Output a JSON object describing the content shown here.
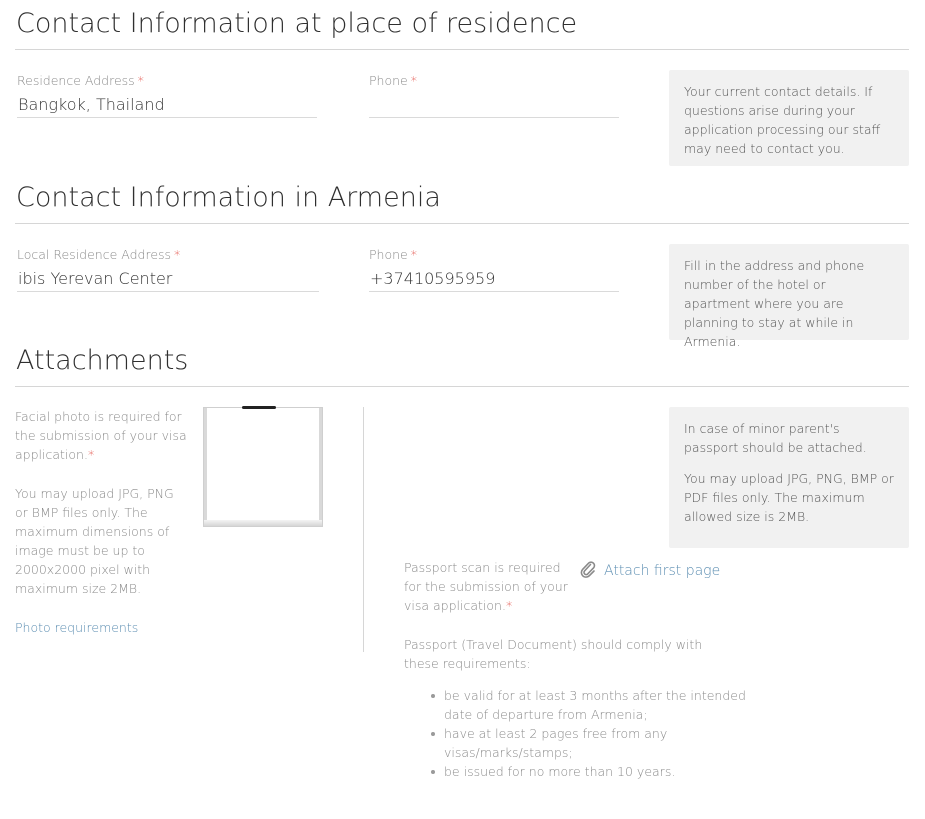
{
  "section_residence": {
    "title": "Contact Information at place of residence",
    "address_label": "Residence Address",
    "address_value": "Bangkok, Thailand",
    "phone_label": "Phone",
    "phone_value": "",
    "required_mark": "*",
    "info": "Your current contact details. If questions arise during your application processing our staff may need to contact you."
  },
  "section_armenia": {
    "title": "Contact Information in Armenia",
    "address_label": "Local Residence Address",
    "address_value": "ibis Yerevan Center",
    "phone_label": "Phone",
    "phone_value": "+37410595959",
    "required_mark": "*",
    "info": "Fill in the address and phone number of the hotel or apartment where you are planning to stay at while in Armenia."
  },
  "section_attachments": {
    "title": "Attachments",
    "photo_required": "Facial photo is required for the submission of your visa application.",
    "required_mark": "*",
    "photo_formats": "You may upload JPG, PNG or BMP files only. The maximum dimensions of image must be up to 2000x2000 pixel with maximum size 2MB.",
    "photo_requirements_link": "Photo requirements",
    "info_minor": "In case of minor parent's passport should be attached.",
    "info_formats": "You may upload JPG, PNG, BMP or PDF files only. The maximum allowed size is 2MB.",
    "passport_required": "Passport scan is required for the submission of your visa application.",
    "attach_label": "Attach first page",
    "passport_comply": "Passport (Travel Document) should comply with these requirements:",
    "requirements": [
      "be valid for at least 3 months after the intended date of departure from Armenia;",
      "have at least 2 pages free from any visas/marks/stamps;",
      "be issued for no more than 10 years."
    ]
  },
  "icons": {
    "attach": "paperclip-icon"
  },
  "colors": {
    "link": "#5b8db1",
    "required": "#e0433a",
    "info_bg": "#f1f1f1"
  }
}
